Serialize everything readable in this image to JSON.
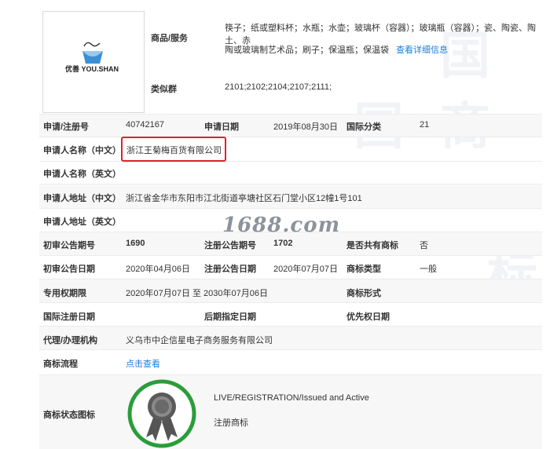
{
  "watermark_text": "1688.com",
  "logo": {
    "text": "优善 YOU.SHAN"
  },
  "goods": {
    "label": "商品/服务",
    "line1": "筷子；纸或塑料杯；水瓶；水壶；玻璃杯（容器）；玻璃瓶（容器）；瓷、陶瓷、陶土、赤",
    "line2": "陶或玻璃制艺术品；刷子；保温瓶；保温袋",
    "detail_link": "查看详细信息"
  },
  "similar_group": {
    "label": "类似群",
    "value": "2101;2102;2104;2107;2111;"
  },
  "fields": {
    "reg_no_label": "申请/注册号",
    "reg_no": "40742167",
    "apply_date_label": "申请日期",
    "apply_date": "2019年08月30日",
    "intl_class_label": "国际分类",
    "intl_class": "21",
    "applicant_cn_label": "申请人名称（中文）",
    "applicant_cn": "浙江王菊梅百货有限公司",
    "applicant_en_label": "申请人名称（英文）",
    "address_cn_label": "申请人地址（中文）",
    "address_cn": "浙江省金华市东阳市江北街道亭塘社区石门堂小区12幢1号101",
    "address_en_label": "申请人地址（英文）",
    "prelim_no_label": "初审公告期号",
    "prelim_no": "1690",
    "reg_pub_no_label": "注册公告期号",
    "reg_pub_no": "1702",
    "shared_label": "是否共有商标",
    "shared": "否",
    "prelim_date_label": "初审公告日期",
    "prelim_date": "2020年04月06日",
    "reg_pub_date_label": "注册公告日期",
    "reg_pub_date": "2020年07月07日",
    "mark_type_label": "商标类型",
    "mark_type": "一般",
    "exclusive_label": "专用权期限",
    "exclusive": "2020年07月07日 至 2030年07月06日",
    "mark_form_label": "商标形式",
    "intl_reg_date_label": "国际注册日期",
    "later_date_label": "后期指定日期",
    "priority_date_label": "优先权日期",
    "agent_label": "代理/办理机构",
    "agent": "义乌市中企信星电子商务服务有限公司",
    "flow_label": "商标流程",
    "flow_link": "点击查看",
    "status_label": "商标状态图标",
    "status_en": "LIVE/REGISTRATION/Issued and Active",
    "status_cn": "注册商标"
  },
  "colors": {
    "red_highlight": "#e0202a",
    "link_blue": "#1a7ed8",
    "badge_green": "#2a9d3a"
  },
  "icons": {
    "status_badge": "award-ribbon-icon",
    "logo_mark": "cup-icon"
  }
}
